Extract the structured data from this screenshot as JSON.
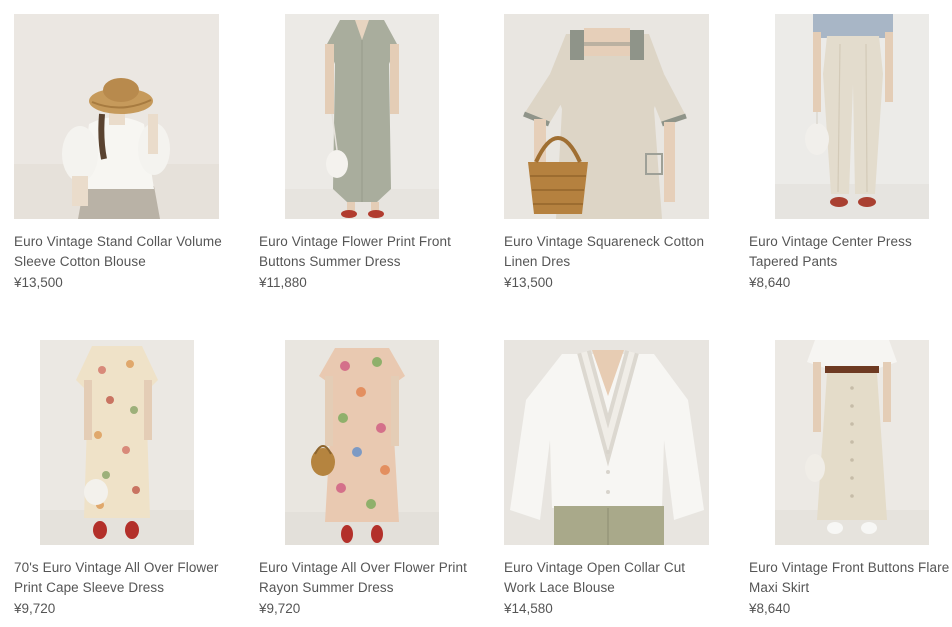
{
  "products": [
    {
      "title": "Euro Vintage Stand Collar Volume Sleeve Cotton Blouse",
      "price": "¥13,500",
      "image": "woman in straw hat and white puff-sleeve blouse"
    },
    {
      "title": "Euro Vintage Flower Print Front Buttons Summer Dress",
      "price": "¥11,880",
      "image": "long sage green flower print dress with white drawstring bag"
    },
    {
      "title": "Euro Vintage Squareneck Cotton Linen Dres",
      "price": "¥13,500",
      "image": "beige squareneck linen dress with striped trim and wicker basket"
    },
    {
      "title": "Euro Vintage Center Press Tapered Pants",
      "price": "¥8,640",
      "image": "cream tapered pants with blue top and red shoes"
    },
    {
      "title": "70's Euro Vintage All Over Flower Print Cape Sleeve Dress",
      "price": "¥9,720",
      "image": "cream floral cape sleeve dress with red flats"
    },
    {
      "title": "Euro Vintage All Over Flower Print Rayon Summer Dress",
      "price": "¥9,720",
      "image": "multicolor floral rayon dress with basket bag"
    },
    {
      "title": "Euro Vintage Open Collar Cut Work Lace Blouse",
      "price": "¥14,580",
      "image": "white cut work lace blouse with ruffle collar"
    },
    {
      "title": "Euro Vintage Front Buttons Flare Maxi Skirt",
      "price": "¥8,640",
      "image": "cream front button flare maxi skirt with brown belt"
    }
  ],
  "colors": {
    "text": "#555555",
    "background": "#ffffff",
    "photo_backdrop": "#ebe7e1"
  }
}
